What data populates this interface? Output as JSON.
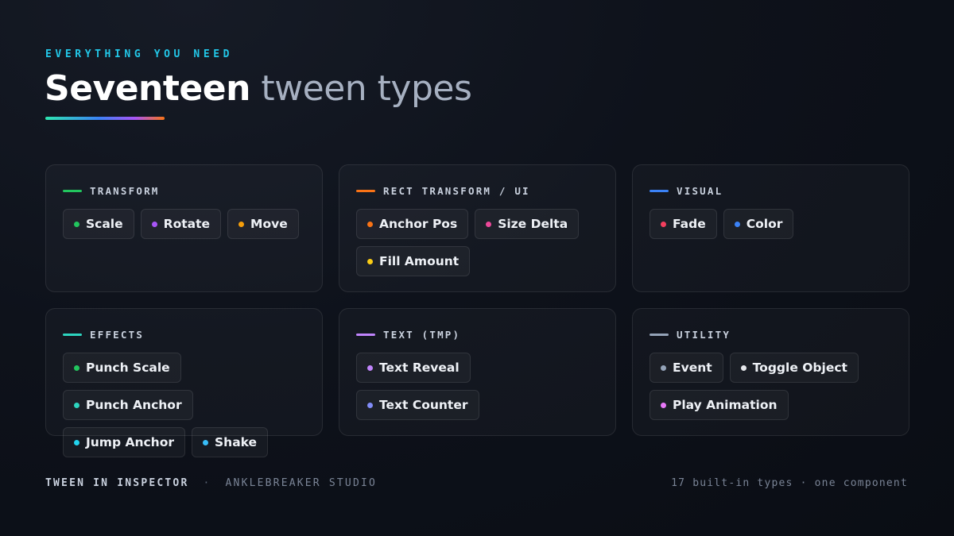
{
  "header": {
    "eyebrow": "EVERYTHING YOU NEED",
    "title_bold": "Seventeen",
    "title_light": "tween types"
  },
  "accent_gradient": [
    "#2ee6b0",
    "#3b82f6",
    "#a855f7",
    "#f97316"
  ],
  "cards": [
    {
      "title": "TRANSFORM",
      "color": "#22c55e",
      "items": [
        {
          "label": "Scale",
          "color": "#22c55e"
        },
        {
          "label": "Rotate",
          "color": "#a855f7"
        },
        {
          "label": "Move",
          "color": "#f59e0b"
        }
      ]
    },
    {
      "title": "RECT TRANSFORM / UI",
      "color": "#f97316",
      "items": [
        {
          "label": "Anchor Pos",
          "color": "#f97316"
        },
        {
          "label": "Size Delta",
          "color": "#ec4899"
        },
        {
          "label": "Fill Amount",
          "color": "#facc15"
        }
      ]
    },
    {
      "title": "VISUAL",
      "color": "#3b82f6",
      "items": [
        {
          "label": "Fade",
          "color": "#f43f5e"
        },
        {
          "label": "Color",
          "color": "#3b82f6"
        }
      ]
    },
    {
      "title": "EFFECTS",
      "color": "#2dd4bf",
      "items": [
        {
          "label": "Punch Scale",
          "color": "#22c55e"
        },
        {
          "label": "Punch Anchor",
          "color": "#2dd4bf"
        },
        {
          "label": "Jump Anchor",
          "color": "#22d3ee"
        },
        {
          "label": "Shake",
          "color": "#38bdf8"
        }
      ]
    },
    {
      "title": "TEXT (TMP)",
      "color": "#c084fc",
      "items": [
        {
          "label": "Text Reveal",
          "color": "#c084fc"
        },
        {
          "label": "Text Counter",
          "color": "#818cf8"
        }
      ]
    },
    {
      "title": "UTILITY",
      "color": "#94a3b8",
      "items": [
        {
          "label": "Event",
          "color": "#94a3b8"
        },
        {
          "label": "Toggle Object",
          "color": "#e5e7eb"
        },
        {
          "label": "Play Animation",
          "color": "#e879f9"
        }
      ]
    }
  ],
  "footer": {
    "brand": "TWEEN IN INSPECTOR",
    "separator": "·",
    "studio": "ANKLEBREAKER STUDIO",
    "right": "17 built-in types · one component"
  }
}
